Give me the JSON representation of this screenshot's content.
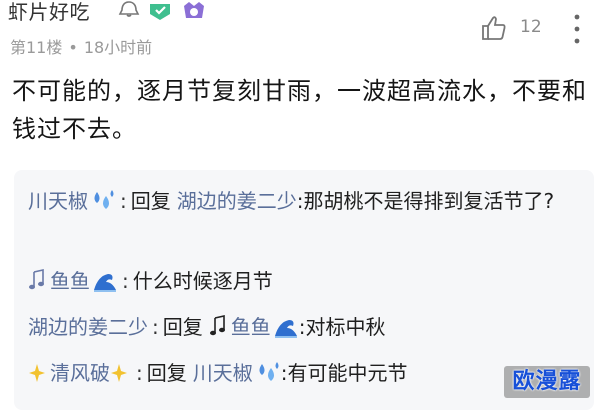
{
  "header": {
    "username": "虾片好吃",
    "icons": [
      "follow-bell-icon",
      "green-badge-icon",
      "purple-badge-icon"
    ]
  },
  "meta": {
    "floor": "第11楼",
    "separator": "•",
    "time": "18小时前"
  },
  "like": {
    "icon": "thumbs-up-icon",
    "count": "12"
  },
  "more": {
    "icon": "more-vertical-icon"
  },
  "comment": {
    "text": "不可能的，逐月节复刻甘雨，一波超高流水，不要和钱过不去。"
  },
  "replies": [
    {
      "author": "川天椒",
      "author_emoji": "water-drops-emoji",
      "reply_word": "回复",
      "target": "湖边的姜二少",
      "text": ":那胡桃不是得排到复活节了?"
    },
    {
      "author": "鱼鱼",
      "author_prefix_emoji": "music-note-emoji",
      "author_emoji": "wave-emoji",
      "text": "什么时候逐月节"
    },
    {
      "author": "湖边的姜二少",
      "reply_word": "回复",
      "target": "鱼鱼",
      "target_prefix_emoji": "music-note-emoji",
      "target_emoji": "wave-emoji",
      "text": ":对标中秋"
    },
    {
      "author": "清风破",
      "author_prefix_emoji": "sparkles-emoji",
      "author_emoji": "sparkles-emoji",
      "reply_word": "回复",
      "target": "川天椒",
      "target_emoji": "water-drops-emoji",
      "text": ":有可能中元节"
    }
  ],
  "watermark": {
    "text": "欧漫露"
  },
  "colors": {
    "name": "#5a6f9a",
    "meta": "#9a9a9a",
    "reply_bg": "#f6f7f9",
    "badge_green": "#3fbf8f",
    "badge_purple": "#8b6fd6",
    "watermark_text": "#1750d8"
  }
}
